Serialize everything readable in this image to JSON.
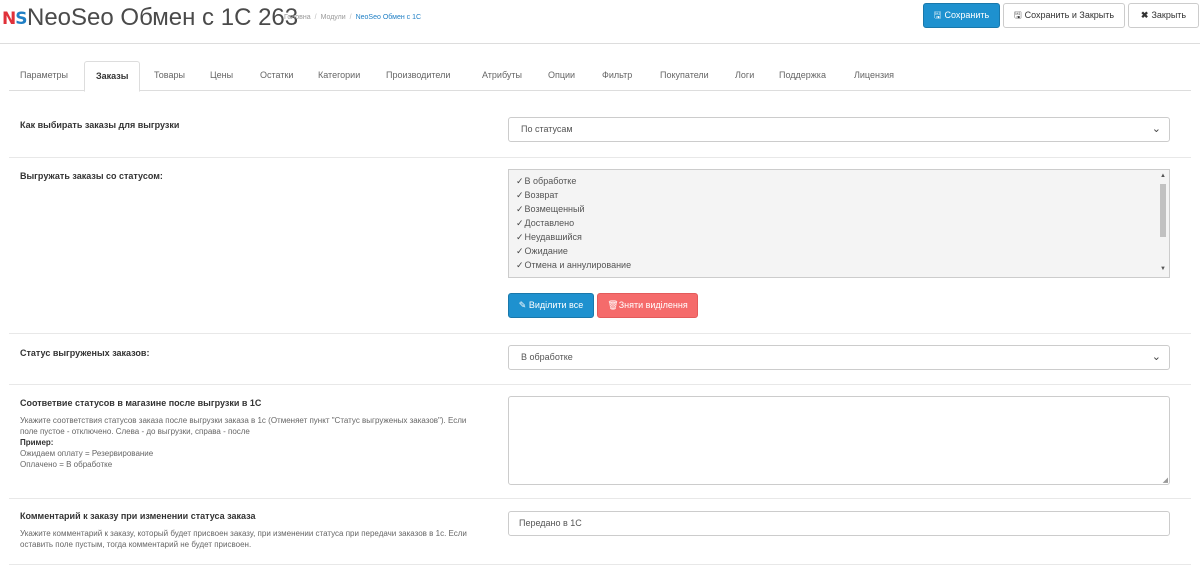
{
  "header": {
    "logo_n": "N",
    "logo_s": "S",
    "title": "NeoSeo Обмен с 1С 263",
    "breadcrumbs": [
      "Головна",
      "Модули",
      "NeoSeo Обмен с 1С"
    ],
    "buttons": {
      "save": "Сохранить",
      "save_close": "Сохранить и Закрыть",
      "close": "Закрыть"
    }
  },
  "tabs": [
    "Параметры",
    "Заказы",
    "Товары",
    "Цены",
    "Остатки",
    "Категории",
    "Производители",
    "Атрибуты",
    "Опции",
    "Фильтр",
    "Покупатели",
    "Логи",
    "Поддержка",
    "Лицензия"
  ],
  "active_tab": "Заказы",
  "form": {
    "select_method": {
      "label": "Как выбирать заказы для выгрузки",
      "value": "По статусам"
    },
    "export_statuses": {
      "label": "Выгружать заказы со статусом:",
      "items": [
        "В обработке",
        "Возврат",
        "Возмещенный",
        "Доставлено",
        "Неудавшийся",
        "Ожидание",
        "Отмена и аннулирование"
      ],
      "select_all": "Виділити все",
      "unselect": "Зняти виділення"
    },
    "exported_status": {
      "label": "Статус выгруженых заказов:",
      "value": "В обработке"
    },
    "status_mapping": {
      "label": "Соответвие статусов в магазине после выгрузки в 1С",
      "help1": "Укажите соответствия статусов заказа после выгрузки заказа в 1с (Отменяет пункт \"Статус выгруженых заказов\"). Если поле пустое - отключено. Слева - до выгрузки, справа - после",
      "example_label": "Пример:",
      "example1": "Ожидаем оплату = Резервирование",
      "example2": "Оплачено = В обработке",
      "value": ""
    },
    "comment": {
      "label": "Комментарий к заказу при изменении статуса заказа",
      "help": "Укажите комментарий к заказу, который будет присвоен заказу, при изменении статуса при передачи заказов в 1с. Если оставить поле пустым, тогда комментарий не будет присвоен.",
      "value": "Передано в 1С"
    }
  },
  "icons": {
    "save": "floppy-icon",
    "close": "x-icon",
    "check": "check-icon",
    "chevron": "chevron-down-icon"
  },
  "colors": {
    "primary": "#1e91cf",
    "danger": "#f56b6b",
    "logo_red": "#e0313a",
    "logo_blue": "#1f7fc5"
  }
}
